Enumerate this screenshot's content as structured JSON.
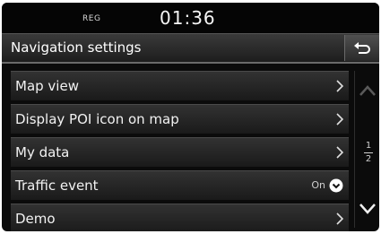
{
  "status": {
    "reg": "REG",
    "clock": "01:36"
  },
  "header": {
    "title": "Navigation settings"
  },
  "menu": {
    "items": [
      {
        "label": "Map view"
      },
      {
        "label": "Display POI icon on map"
      },
      {
        "label": "My data"
      },
      {
        "label": "Traffic event",
        "status": "On"
      },
      {
        "label": "Demo"
      }
    ]
  },
  "pager": {
    "current": "1",
    "total": "2"
  },
  "icons": {
    "back": "back-arrow-icon",
    "chevron": "chevron-right-icon",
    "toggle": "chevron-down-circle-icon",
    "scroll_up": "chevron-up-icon",
    "scroll_down": "chevron-down-icon"
  },
  "colors": {
    "background": "#0b0b0b",
    "row": "#2a2a2a",
    "text": "#f2f2f2"
  }
}
